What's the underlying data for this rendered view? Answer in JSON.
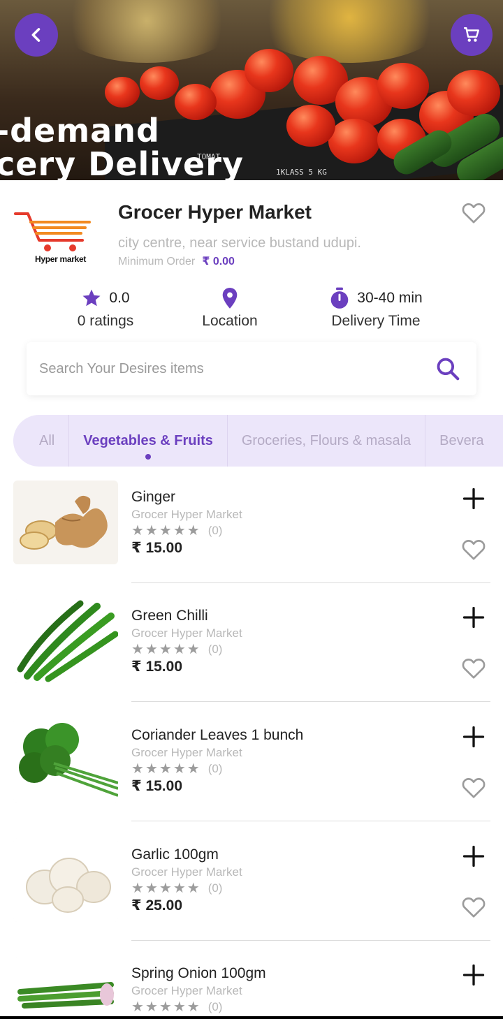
{
  "hero": {
    "banner_line1": "-demand",
    "banner_line2": "cery Delivery",
    "crate_label1": "TOMAT",
    "crate_label2": "1KLASS 5 KG"
  },
  "store": {
    "name": "Grocer Hyper Market",
    "logo_text": "Hyper market",
    "address": "city centre, near service bustand udupi.",
    "min_order_label": "Minimum Order",
    "min_order_value": "₹ 0.00"
  },
  "stats": {
    "rating_value": "0.0",
    "rating_label": "0 ratings",
    "location_label": "Location",
    "delivery_value": "30-40 min",
    "delivery_label": "Delivery Time"
  },
  "search": {
    "placeholder": "Search Your Desires items"
  },
  "categories": [
    {
      "label": "All",
      "active": false
    },
    {
      "label": "Vegetables & Fruits",
      "active": true
    },
    {
      "label": "Groceries, Flours & masala",
      "active": false
    },
    {
      "label": "Bevera",
      "active": false
    }
  ],
  "products": [
    {
      "name": "Ginger",
      "store": "Grocer Hyper Market",
      "rating_count": "(0)",
      "rating": 0,
      "price": "₹ 15.00",
      "image": "ginger"
    },
    {
      "name": "Green Chilli",
      "store": "Grocer Hyper Market",
      "rating_count": "(0)",
      "rating": 0,
      "price": "₹ 15.00",
      "image": "green-chilli"
    },
    {
      "name": "Coriander Leaves 1 bunch",
      "store": "Grocer Hyper Market",
      "rating_count": "(0)",
      "rating": 0,
      "price": "₹ 15.00",
      "image": "coriander"
    },
    {
      "name": "Garlic 100gm",
      "store": "Grocer Hyper Market",
      "rating_count": "(0)",
      "rating": 0,
      "price": "₹ 25.00",
      "image": "garlic"
    },
    {
      "name": "Spring Onion 100gm",
      "store": "Grocer Hyper Market",
      "rating_count": "(0)",
      "rating": 0,
      "price": "",
      "image": "spring-onion"
    }
  ],
  "colors": {
    "accent": "#6b3fbf",
    "tab_background": "#ece6fa",
    "muted_text": "#b8b8b8"
  }
}
